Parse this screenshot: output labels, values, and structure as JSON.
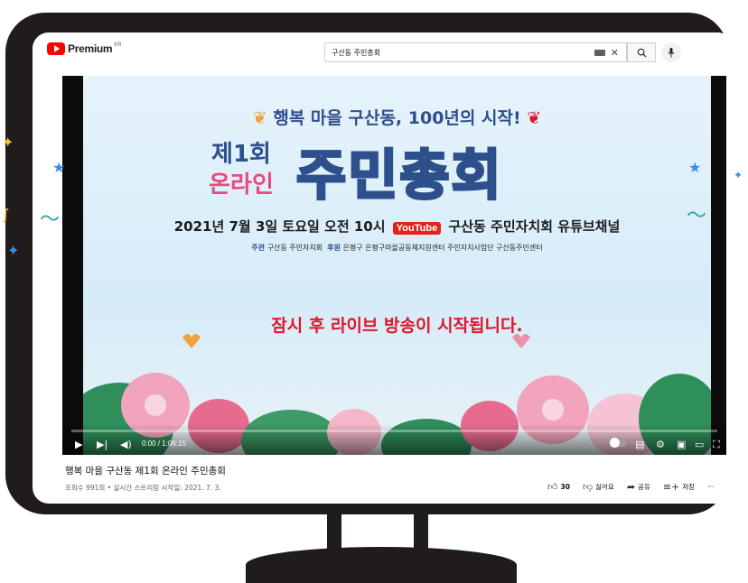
{
  "header": {
    "logo_text": "Premium",
    "logo_region": "KR",
    "search_value": "구산동 주민총회"
  },
  "video": {
    "subtitle": "행복 마을 구산동, 100년의 시작!",
    "left_line1": "제1회",
    "left_line2": "온라인",
    "big_title": "주민총회",
    "date_line_pre": "2021년 7월 3일 토요일 오전 10시",
    "date_line_youtube": "YouTube",
    "date_line_post": "구산동 주민자치회 유튜브채널",
    "org_host_label": "주관",
    "org_host": "구산동 주민자치회",
    "org_sponsor_label": "후원",
    "org_sponsors": "은평구  은평구마을공동체지원센터 주민자치사업단 구산동주민센터",
    "notice": "잠시 후 라이브 방송이 시작됩니다."
  },
  "player": {
    "time": "0:00 / 1:06:15"
  },
  "info": {
    "title": "행복 마을 구산동 제1회 온라인 주민총회",
    "meta": "조회수 991회 • 실시간 스트리밍 시작일: 2021. 7. 3.",
    "like_count": "30",
    "dislike_label": "싫어요",
    "share_label": "공유",
    "save_label": "저장",
    "more_label": "···"
  }
}
